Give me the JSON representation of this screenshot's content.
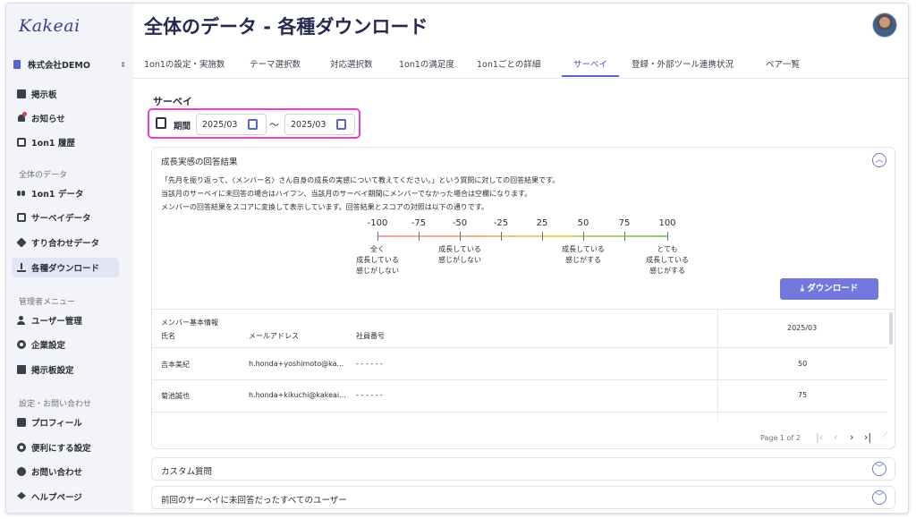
{
  "app": {
    "logo": "Kakeai"
  },
  "sidebar": {
    "company": "株式会社DEMO",
    "items_top": [
      {
        "label": "掲示板",
        "icon": "board-icon"
      },
      {
        "label": "お知らせ",
        "icon": "bell-icon"
      },
      {
        "label": "1on1 履歴",
        "icon": "history-icon"
      }
    ],
    "section_data": "全体のデータ",
    "items_data": [
      {
        "label": "1on1 データ",
        "icon": "people-icon"
      },
      {
        "label": "サーベイデータ",
        "icon": "checklist-icon"
      },
      {
        "label": "すり合わせデータ",
        "icon": "puzzle-icon"
      },
      {
        "label": "各種ダウンロード",
        "icon": "download-icon",
        "active": true
      }
    ],
    "section_admin": "管理者メニュー",
    "items_admin": [
      {
        "label": "ユーザー管理",
        "icon": "user-admin-icon"
      },
      {
        "label": "企業設定",
        "icon": "company-settings-icon"
      },
      {
        "label": "掲示板設定",
        "icon": "board-settings-icon"
      }
    ],
    "section_settings": "設定・お問い合わせ",
    "items_settings": [
      {
        "label": "プロフィール",
        "icon": "profile-icon"
      },
      {
        "label": "便利にする設定",
        "icon": "gear-icon"
      },
      {
        "label": "お問い合わせ",
        "icon": "question-icon"
      },
      {
        "label": "ヘルプページ",
        "icon": "graduation-cap-icon"
      }
    ]
  },
  "header": {
    "title": "全体のデータ - 各種ダウンロード"
  },
  "tabs": [
    "1on1の設定・実施数",
    "テーマ選択数",
    "対応選択数",
    "1on1の満足度",
    "1on1ごとの詳細",
    "サーベイ",
    "登録・外部ツール連携状況",
    "ペア一覧"
  ],
  "active_tab": "サーベイ",
  "survey": {
    "section_title": "サーベイ",
    "period_label": "期間",
    "start": "2025/03",
    "end": "2025/03",
    "separator": "〜"
  },
  "growth_panel": {
    "title": "成長実感の回答結果",
    "desc": [
      "「先月を振り返って、〈メンバー名〉さん自身の成長の実感について教えてください。」という質問に対しての回答結果です。",
      "当該月のサーベイに未回答の場合はハイフン、当該月のサーベイ期間にメンバーでなかった場合は空欄になります。",
      "メンバーの回答結果をスコアに変換して表示しています。回答結果とスコアの対照は以下の通りです。"
    ],
    "scale_ticks": [
      "-100",
      "-75",
      "-50",
      "-25",
      "25",
      "50",
      "75",
      "100"
    ],
    "scale_desc": [
      "全く\n成長している\n感じがしない",
      "成長している\n感じがしない",
      "成長している\n感じがする",
      "とても\n成長している\n感じがする"
    ],
    "download_label": "ダウンロード",
    "table": {
      "group_header": "メンバー基本情報",
      "col_name": "氏名",
      "col_email": "メールアドレス",
      "col_empno": "社員番号",
      "col_month": "2025/03",
      "rows": [
        {
          "name": "吉本美紀",
          "email": "h.honda+yoshimoto@ka...",
          "empno": "- - - - - -",
          "score": "50"
        },
        {
          "name": "菊池誠也",
          "email": "h.honda+kikuchi@kakeai...",
          "empno": "- - - - - -",
          "score": "75"
        }
      ]
    },
    "pager": "Page 1 of 2"
  },
  "accordions": [
    "カスタム質問",
    "前回のサーベイに未回答だったすべてのユーザー"
  ]
}
